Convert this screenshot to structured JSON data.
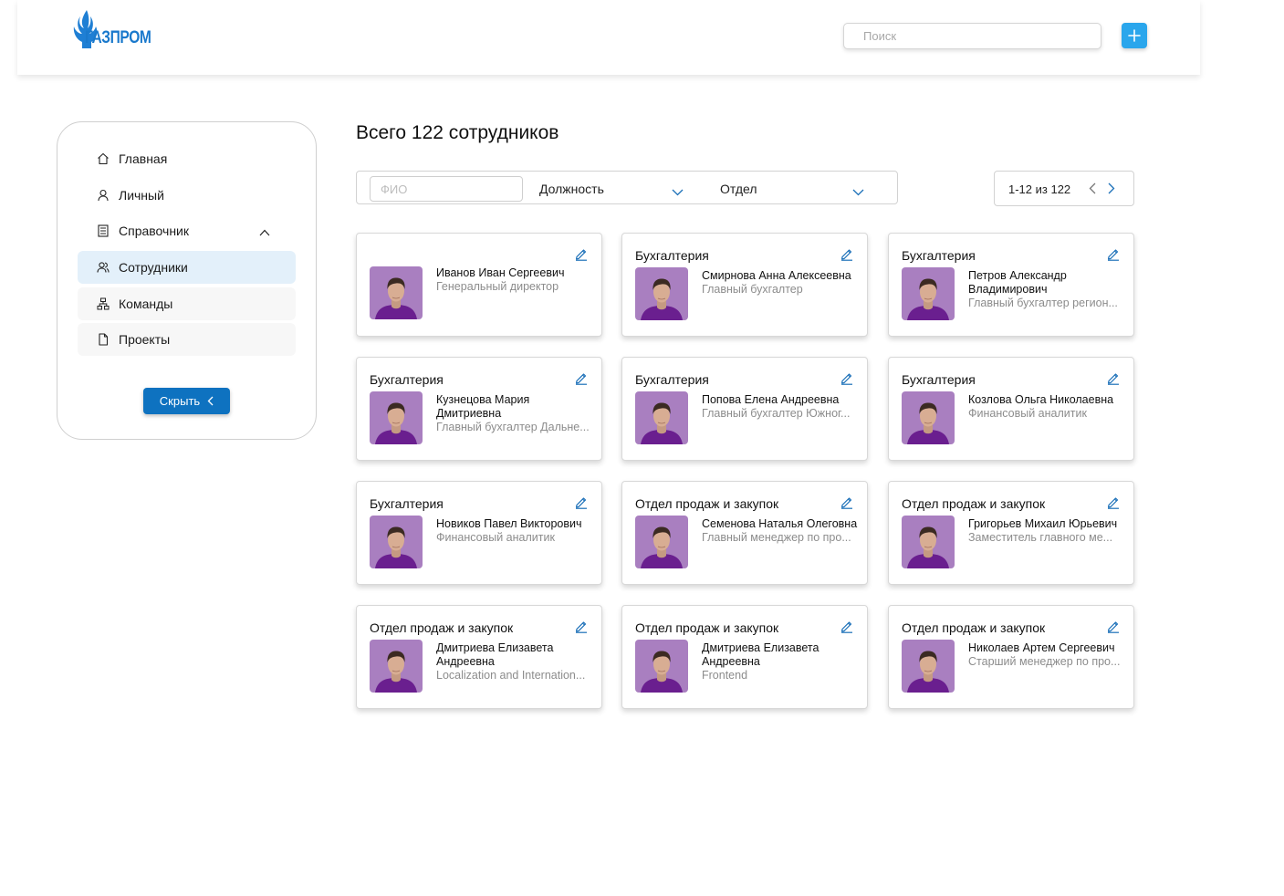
{
  "header": {
    "logo_text": "ГАЗПРОМ",
    "search_placeholder": "Поиск",
    "add_icon": "plus-icon"
  },
  "sidebar": {
    "items": [
      {
        "label": "Главная",
        "icon": "home-icon"
      },
      {
        "label": "Личный",
        "icon": "user-icon"
      },
      {
        "label": "Справочник",
        "icon": "book-icon",
        "expanded": true
      },
      {
        "label": "Сотрудники",
        "icon": "users-icon",
        "active": true
      },
      {
        "label": "Команды",
        "icon": "hierarchy-icon"
      },
      {
        "label": "Проекты",
        "icon": "file-icon"
      }
    ],
    "hide_label": "Скрыть"
  },
  "main": {
    "title": "Всего 122 сотрудников",
    "filters": {
      "fio_placeholder": "ФИО",
      "position_label": "Должность",
      "department_label": "Отдел"
    },
    "pager": {
      "range": "1-12 из 122"
    },
    "cards": [
      {
        "dept": "",
        "name": "Иванов Иван Сергеевич",
        "role": "Генеральный директор"
      },
      {
        "dept": "Бухгалтерия",
        "name": "Смирнова Анна Алексеевна",
        "role": "Главный бухгалтер"
      },
      {
        "dept": "Бухгалтерия",
        "name": "Петров Александр Владимирович",
        "role": "Главный бухгалтер регион..."
      },
      {
        "dept": "Бухгалтерия",
        "name": "Кузнецова Мария Дмитриевна",
        "role": "Главный бухгалтер Дальне..."
      },
      {
        "dept": "Бухгалтерия",
        "name": "Попова Елена Андреевна",
        "role": "Главный бухгалтер Южног..."
      },
      {
        "dept": "Бухгалтерия",
        "name": "Козлова Ольга Николаевна",
        "role": "Финансовый аналитик"
      },
      {
        "dept": "Бухгалтерия",
        "name": "Новиков Павел Викторович",
        "role": "Финансовый аналитик"
      },
      {
        "dept": "Отдел продаж и закупок",
        "name": "Семенова Наталья Олеговна",
        "role": "Главный менеджер по про..."
      },
      {
        "dept": "Отдел продаж и закупок",
        "name": "Григорьев Михаил Юрьевич",
        "role": "Заместитель главного ме..."
      },
      {
        "dept": "Отдел продаж и закупок",
        "name": "Дмитриева Елизавета Андреевна",
        "role": "Localization and Internation..."
      },
      {
        "dept": "Отдел продаж и закупок",
        "name": "Дмитриева Елизавета Андреевна",
        "role": "Frontend"
      },
      {
        "dept": "Отдел продаж и закупок",
        "name": "Николаев Артем Сергеевич",
        "role": "Старший менеджер по про..."
      }
    ]
  },
  "colors": {
    "brand_blue": "#0e72c0",
    "add_button": "#2aa6ec",
    "active_nav": "#e3f0fa",
    "avatar_bg": "#a97fc0",
    "shirt": "#6a1f8f"
  }
}
